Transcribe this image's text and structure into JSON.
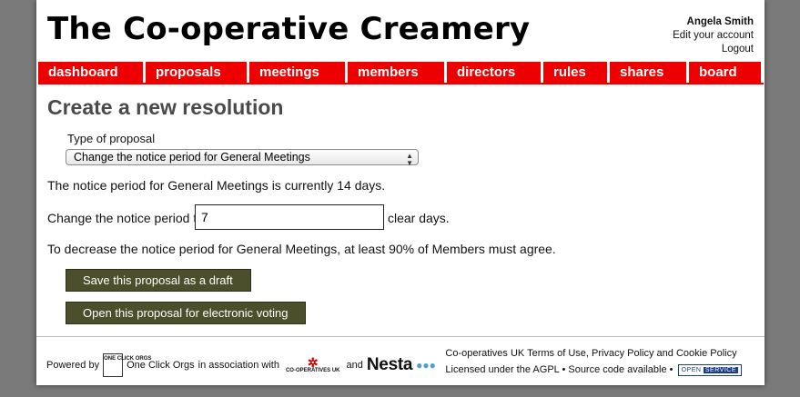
{
  "site": {
    "title": "The Co-operative Creamery"
  },
  "user": {
    "name": "Angela Smith",
    "edit_account": "Edit your account",
    "logout": "Logout"
  },
  "nav": {
    "items": [
      {
        "label": "dashboard"
      },
      {
        "label": "proposals"
      },
      {
        "label": "meetings"
      },
      {
        "label": "members"
      },
      {
        "label": "directors"
      },
      {
        "label": "rules"
      },
      {
        "label": "shares"
      },
      {
        "label": "board"
      }
    ]
  },
  "main": {
    "heading": "Create a new resolution",
    "type_label": "Type of proposal",
    "type_selected": "Change the notice period for General Meetings",
    "current_notice_text": "The notice period for General Meetings is currently 14 days.",
    "change_label": "Change the notice period to",
    "change_value": "7",
    "change_suffix": "clear days.",
    "requirement_text": "To decrease the notice period for General Meetings, at least 90% of Members must agree.",
    "save_draft_button": "Save this proposal as a draft",
    "open_voting_button": "Open this proposal for electronic voting"
  },
  "footer": {
    "powered_by": "Powered by",
    "oco_logo_text": "ONE CLICK ORGS",
    "one_click_orgs": "One Click Orgs",
    "in_association": "in association with",
    "coops_logo_text": "CO-OPERATIVES UK",
    "and": "and",
    "nesta": "Nesta",
    "coops_uk": "Co-operatives UK",
    "terms": "Terms of Use",
    "privacy": "Privacy Policy",
    "and2": "and",
    "cookie": "Cookie Policy",
    "licensed": "Licensed under the AGPL",
    "bullet": "•",
    "source": "Source code available",
    "open_label": "OPEN",
    "service_label": "SERVICE"
  },
  "colors": {
    "nav_red": "#ee0000",
    "button_olive": "#4c4f2b",
    "heading_grey": "#4a4a4a"
  }
}
